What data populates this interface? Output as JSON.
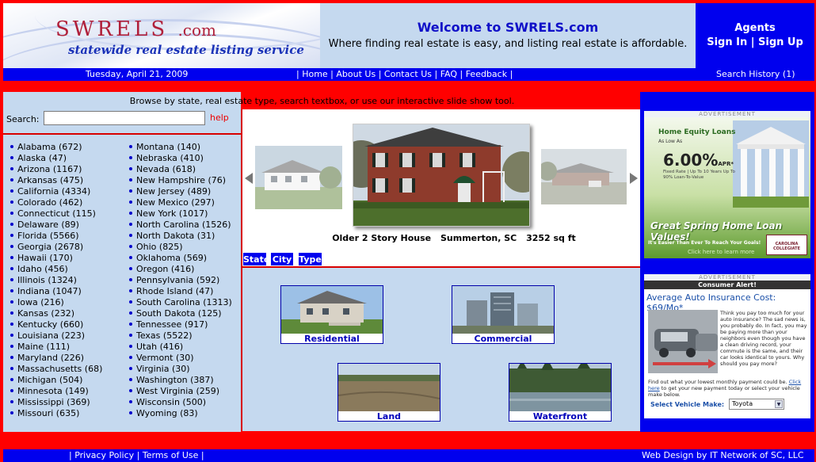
{
  "header": {
    "logo_name": "SWRELS",
    "logo_com": ".com",
    "logo_tagline": "statewide real estate listing service",
    "welcome_title": "Welcome to SWRELS.com",
    "welcome_subtitle": "Where finding real estate is easy, and listing real estate is affordable.",
    "agents_title": "Agents",
    "sign_in": "Sign In",
    "sign_up": "Sign Up"
  },
  "navbar": {
    "date": "Tuesday, April 21, 2009",
    "links": [
      "Home",
      "About Us",
      "Contact Us",
      "FAQ",
      "Feedback"
    ],
    "search_history": "Search History (1)"
  },
  "browse_hint": "Browse by state, real estate type, search textbox, or use our interactive slide show tool.",
  "search": {
    "label": "Search:",
    "value": "",
    "help": "help"
  },
  "states_left": [
    "Alabama (672)",
    "Alaska (47)",
    "Arizona (1167)",
    "Arkansas (475)",
    "California (4334)",
    "Colorado (462)",
    "Connecticut (115)",
    "Delaware (89)",
    "Florida (5566)",
    "Georgia (2678)",
    "Hawaii (170)",
    "Idaho (456)",
    "Illinois (1324)",
    "Indiana (1047)",
    "Iowa (216)",
    "Kansas (232)",
    "Kentucky (660)",
    "Louisiana (223)",
    "Maine (111)",
    "Maryland (226)",
    "Massachusetts (68)",
    "Michigan (504)",
    "Minnesota (149)",
    "Mississippi (369)",
    "Missouri (635)"
  ],
  "states_right": [
    "Montana (140)",
    "Nebraska (410)",
    "Nevada (618)",
    "New Hampshire (76)",
    "New Jersey (489)",
    "New Mexico (297)",
    "New York (1017)",
    "North Carolina (1526)",
    "North Dakota (31)",
    "Ohio (825)",
    "Oklahoma (569)",
    "Oregon (416)",
    "Pennsylvania (592)",
    "Rhode Island (47)",
    "South Carolina (1313)",
    "South Dakota (125)",
    "Tennessee (917)",
    "Texas (5522)",
    "Utah (416)",
    "Vermont (30)",
    "Virginia (30)",
    "Washington (387)",
    "West Virginia (259)",
    "Wisconsin (500)",
    "Wyoming (83)"
  ],
  "slideshow": {
    "caption_type": "Older 2 Story House",
    "caption_city": "Summerton, SC",
    "caption_size": "3252 sq ft"
  },
  "tabs": [
    "State",
    "City",
    "Type"
  ],
  "property_types": [
    "Residential",
    "Commercial",
    "Land",
    "Waterfront"
  ],
  "ads": {
    "label": "ADVERTISEMENT",
    "ad1": {
      "headline": "Home Equity Loans",
      "as_low_as": "As Low As",
      "rate": "6.00%",
      "apr": "APR*",
      "fine": "Fixed Rate | Up To 10 Years Up To 90% Loan-To-Value",
      "slogan": "Great Spring Home Loan Values!",
      "sub": "It's Easier Than Ever To Reach Your Goals!",
      "click": "Click here to learn more",
      "logo": "CAROLINA COLLEGIATE"
    },
    "ad2": {
      "header": "Consumer Alert!",
      "title": "Average Auto Insurance Cost: $69/Mo*",
      "body": "Think you pay too much for your auto insurance? The sad news is, you probably do. In fact, you may be paying more than your neighbors even though you have a clean driving record, your commute is the same, and their car looks identical to yours. Why should you pay more?",
      "bottom_pre": "Find out what your lowest monthly payment could be.",
      "bottom_link": "Click here",
      "bottom_post": "to get your new payment today or select your vehicle make below.",
      "vehicle_label": "Select Vehicle Make:",
      "vehicle_value": "Toyota"
    }
  },
  "footer": {
    "links": [
      "Privacy Policy",
      "Terms of Use"
    ],
    "credit": "Web Design by IT Network of SC, LLC"
  },
  "colors": {
    "blue": "#0000ee",
    "red": "#ff0000",
    "panel": "#c5d9ef",
    "logo_red": "#b0203a"
  }
}
